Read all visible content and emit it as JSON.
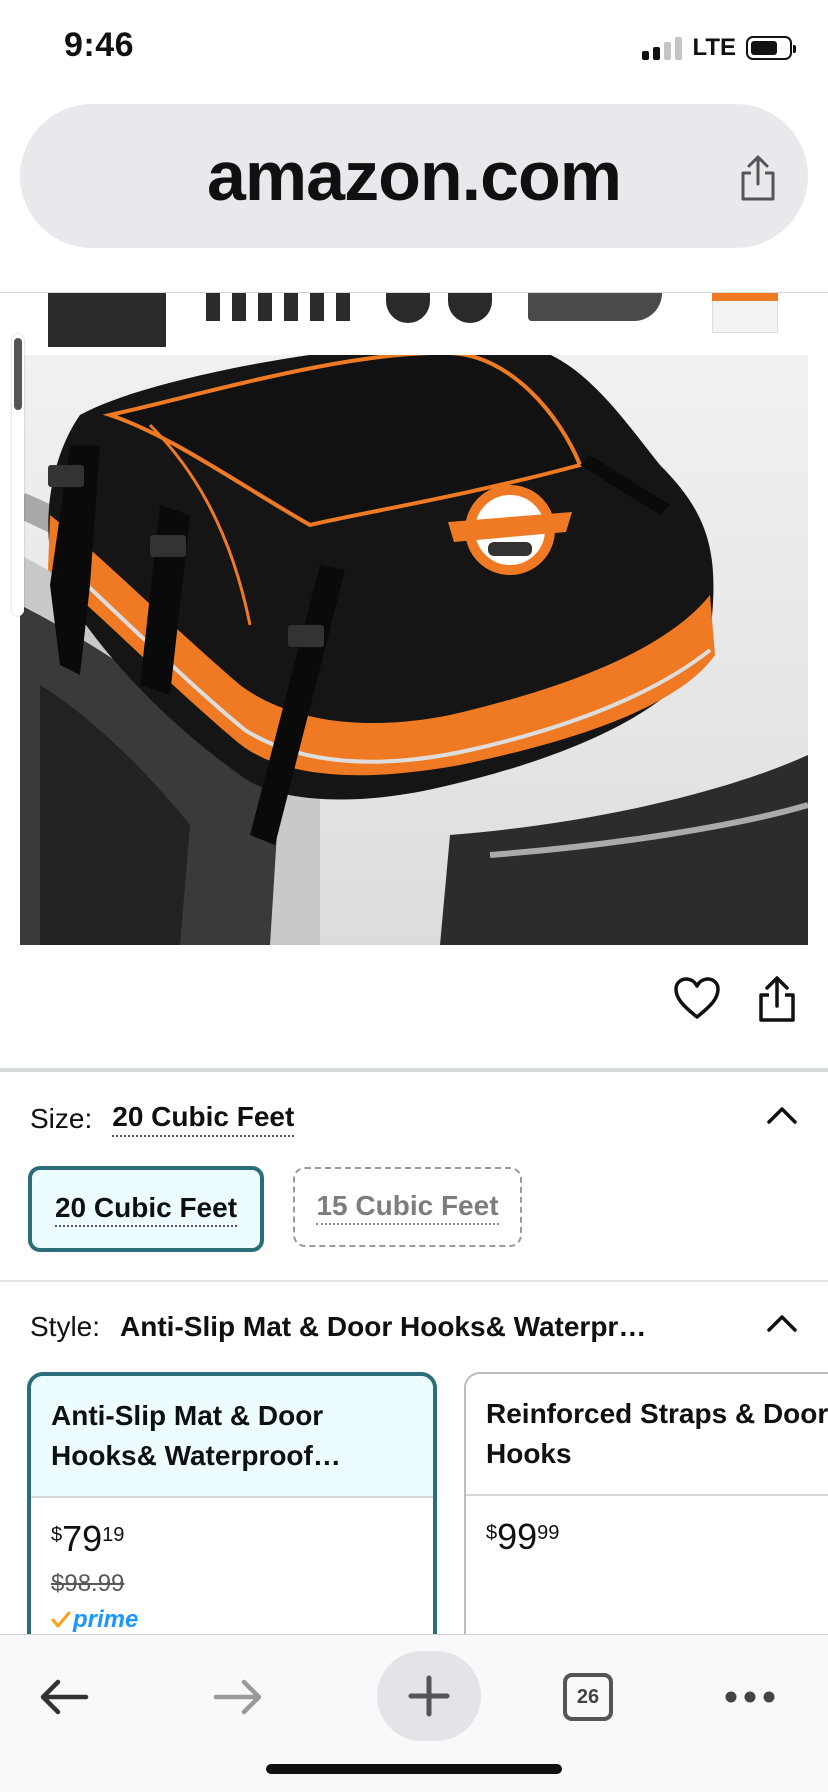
{
  "status_bar": {
    "time": "9:46",
    "network": "LTE"
  },
  "browser": {
    "url": "amazon.com",
    "open_tabs": "26"
  },
  "size": {
    "label": "Size:",
    "selected": "20 Cubic Feet",
    "options": [
      {
        "label": "20 Cubic Feet",
        "state": "selected"
      },
      {
        "label": "15 Cubic Feet",
        "state": "unavailable"
      }
    ]
  },
  "style": {
    "label": "Style:",
    "selected": "Anti-Slip Mat & Door Hooks& Waterpr…",
    "options": [
      {
        "title": "Anti-Slip Mat & Door Hooks& Waterproof…",
        "price_symbol": "$",
        "price_whole": "79",
        "price_fraction": "19",
        "list_price": "$98.99",
        "badge": "prime"
      },
      {
        "title": "Reinforced Straps & Door Hooks",
        "price_symbol": "$",
        "price_whole": "99",
        "price_fraction": "99"
      }
    ]
  },
  "colors": {
    "accent_teal": "#2b6d78",
    "selected_bg": "#edfdff",
    "prime_blue": "#1a98ff",
    "bag_orange": "#f07a23"
  },
  "icons": [
    "share-icon",
    "heart-icon",
    "chevron-up-icon",
    "back-arrow-icon",
    "forward-arrow-icon",
    "plus-icon",
    "more-icon"
  ]
}
